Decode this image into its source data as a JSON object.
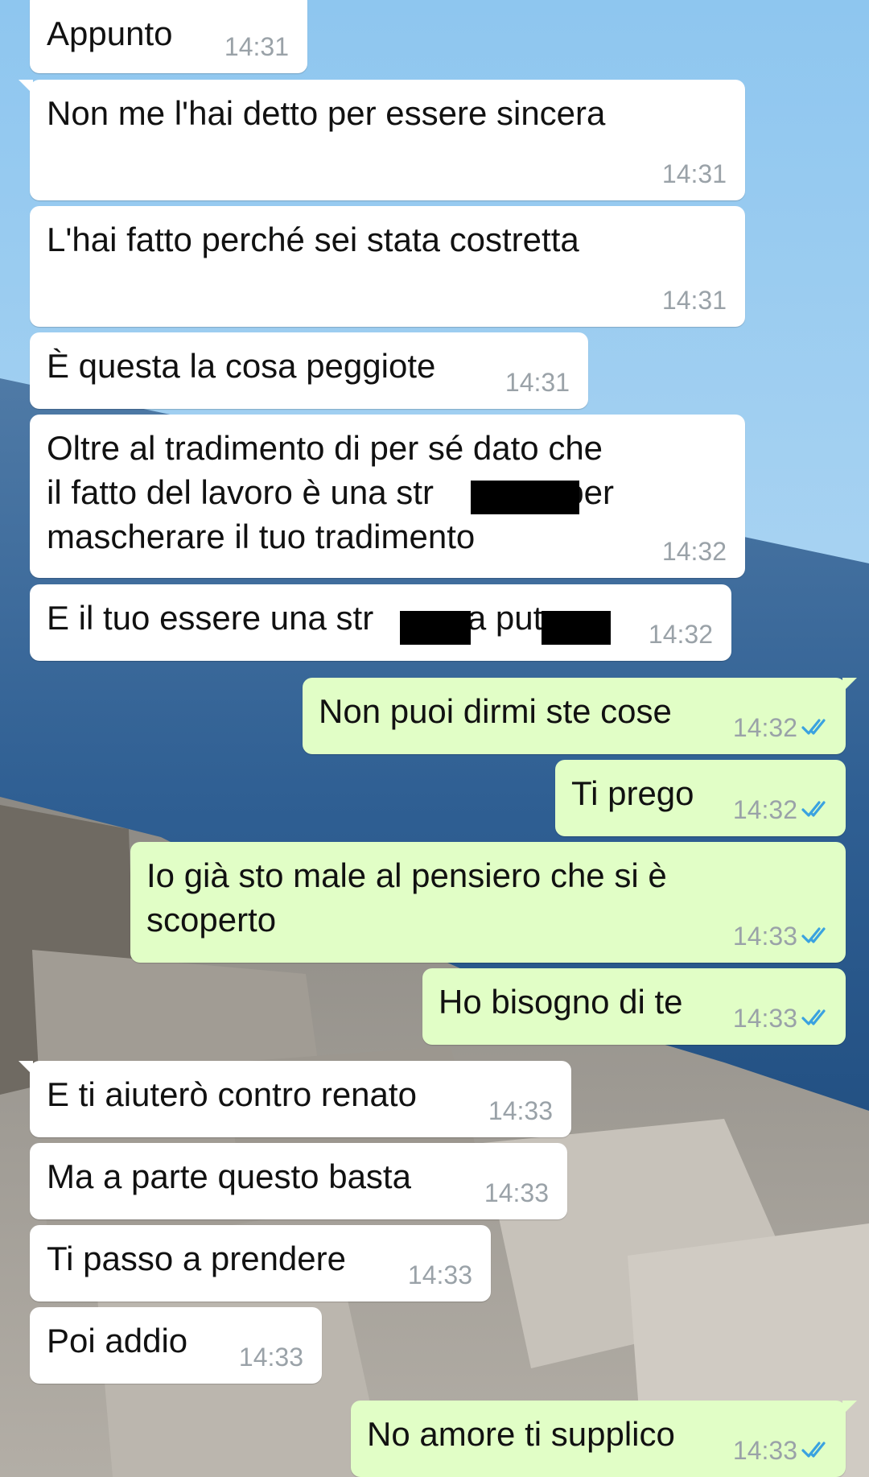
{
  "messages": [
    {
      "dir": "in",
      "text": "Appunto",
      "time": "14:31"
    },
    {
      "dir": "in",
      "text": "Non me l'hai detto per essere sincera",
      "time": "14:31"
    },
    {
      "dir": "in",
      "text": "L'hai fatto perché sei stata costretta",
      "time": "14:31"
    },
    {
      "dir": "in",
      "text": "È questa la cosa peggiote",
      "time": "14:31"
    },
    {
      "dir": "in",
      "text": "Oltre al tradimento di per sé dato che\nil fatto del lavoro è una str              per\nmascherare il tuo tradimento",
      "time": "14:32"
    },
    {
      "dir": "in",
      "text": "E il tuo essere una str          a put",
      "time": "14:32"
    },
    {
      "dir": "out",
      "text": "Non puoi dirmi ste cose",
      "time": "14:32",
      "status": "read"
    },
    {
      "dir": "out",
      "text": "Ti prego",
      "time": "14:32",
      "status": "read"
    },
    {
      "dir": "out",
      "text": "Io già sto male al pensiero che si è\nscoperto",
      "time": "14:33",
      "status": "read"
    },
    {
      "dir": "out",
      "text": "Ho bisogno di te",
      "time": "14:33",
      "status": "read"
    },
    {
      "dir": "in",
      "text": "E ti aiuterò contro renato",
      "time": "14:33"
    },
    {
      "dir": "in",
      "text": "Ma a parte questo basta",
      "time": "14:33"
    },
    {
      "dir": "in",
      "text": "Ti passo a prendere",
      "time": "14:33"
    },
    {
      "dir": "in",
      "text": "Poi addio",
      "time": "14:33"
    },
    {
      "dir": "out",
      "text": "No amore ti supplico",
      "time": "14:33",
      "status": "read"
    }
  ],
  "colors": {
    "incoming_bubble": "#ffffff",
    "outgoing_bubble": "#e1fec6",
    "timestamp": "#9aa2a8",
    "read_tick": "#3aa2e0",
    "redaction": "#000000"
  },
  "icons": {
    "read_status": "double-check-icon"
  }
}
